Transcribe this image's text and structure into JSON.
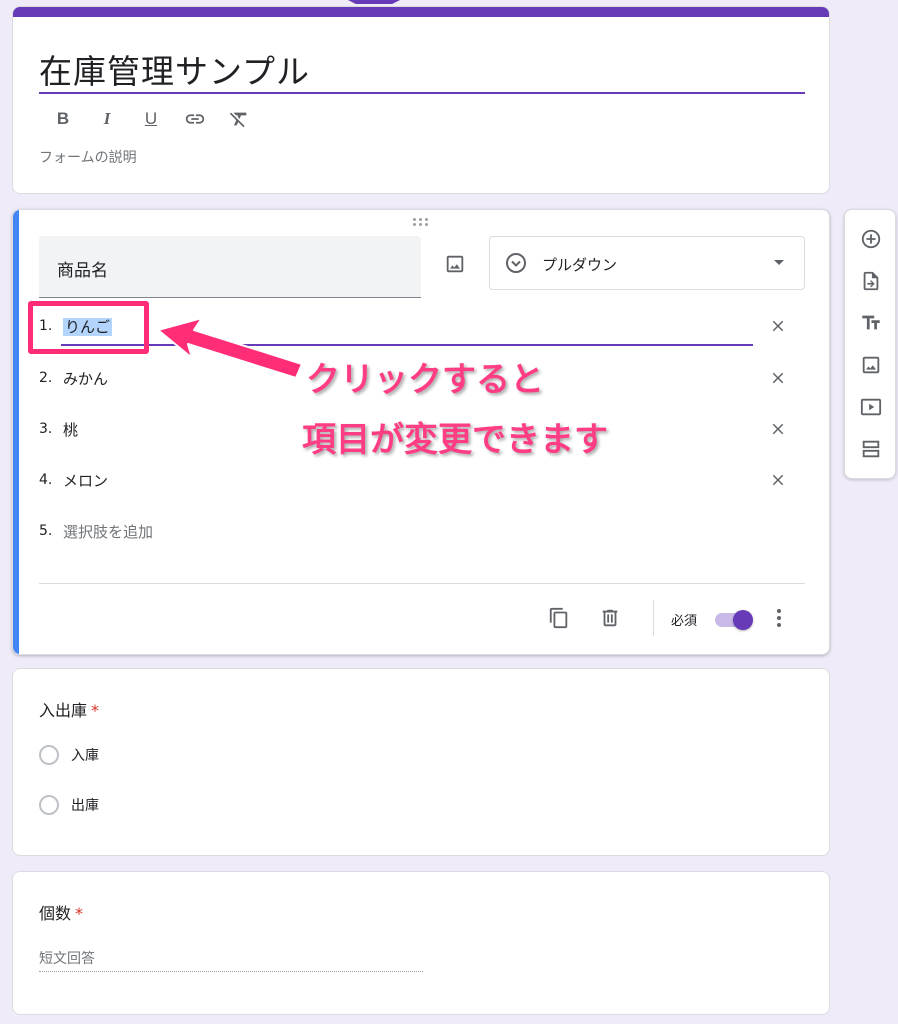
{
  "form": {
    "title": "在庫管理サンプル",
    "description_placeholder": "フォームの説明",
    "accent_color": "#673ab7",
    "format_toolbar": [
      {
        "label": "B",
        "icon": "bold-icon"
      },
      {
        "label": "I",
        "icon": "italic-icon"
      },
      {
        "label": "U",
        "icon": "underline-icon"
      },
      {
        "label": "",
        "icon": "link-icon"
      },
      {
        "label": "",
        "icon": "clear-format-icon"
      }
    ]
  },
  "question1": {
    "title": "商品名",
    "type": "プルダウン",
    "options": [
      {
        "num": "1.",
        "label": "りんご"
      },
      {
        "num": "2.",
        "label": "みかん"
      },
      {
        "num": "3.",
        "label": "桃"
      },
      {
        "num": "4.",
        "label": "メロン"
      }
    ],
    "add_option": {
      "num": "5.",
      "label": "選択肢を追加"
    },
    "required_label": "必須",
    "required": true,
    "active_bar_color": "#4285f4"
  },
  "question2": {
    "title": "入出庫",
    "required_mark": "*",
    "options": [
      "入庫",
      "出庫"
    ]
  },
  "question3": {
    "title": "個数",
    "required_mark": "*",
    "answer_placeholder": "短文回答"
  },
  "side_toolbar": [
    "add-question-icon",
    "import-questions-icon",
    "add-title-icon",
    "add-image-icon",
    "add-video-icon",
    "add-section-icon"
  ],
  "annotation": {
    "line1": "クリックすると",
    "line2": "項目が変更できます",
    "color": "#ff2d78"
  }
}
